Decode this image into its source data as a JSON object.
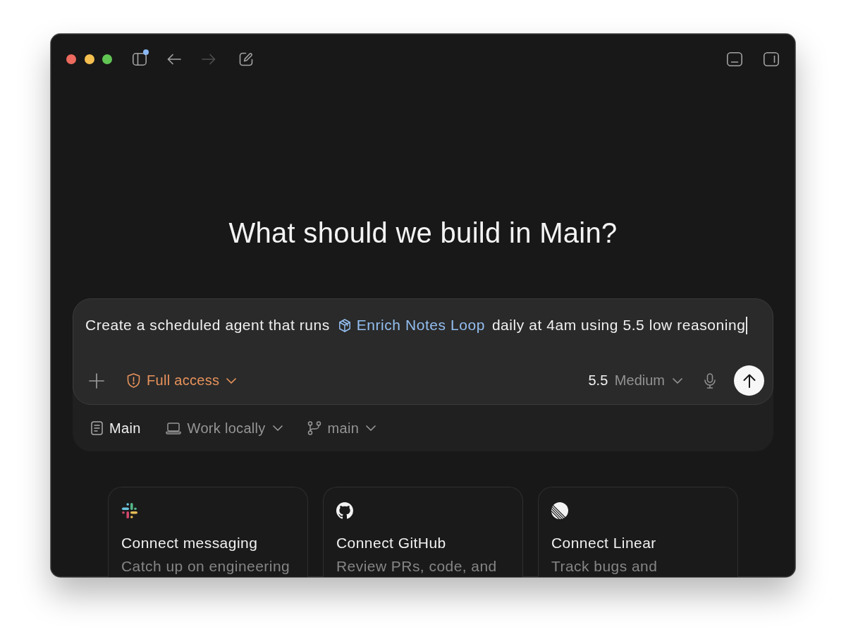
{
  "toolbar": {
    "left": [
      {
        "kind": "sidebar",
        "badge": true,
        "disabled": false
      },
      {
        "kind": "back",
        "badge": false,
        "disabled": false
      },
      {
        "kind": "forward",
        "badge": false,
        "disabled": true
      },
      {
        "kind": "compose",
        "badge": false,
        "disabled": false
      }
    ],
    "right": [
      {
        "kind": "bottom-panel"
      },
      {
        "kind": "side-panel"
      }
    ]
  },
  "heading": "What should we build in Main?",
  "composer": {
    "prompt": {
      "focused": true,
      "segments": [
        {
          "kind": "text",
          "text": "Create a scheduled agent that runs"
        },
        {
          "kind": "mention",
          "text": "Enrich Notes Loop"
        },
        {
          "kind": "text",
          "text": "daily at 4am using 5.5 low reasoning"
        }
      ]
    },
    "access": {
      "label": "Full access",
      "warning": true
    },
    "model": {
      "version": "5.5",
      "effort": "Medium"
    }
  },
  "context": [
    {
      "kind": "project",
      "label": "Main",
      "dropdown": false
    },
    {
      "kind": "environment",
      "label": "Work locally",
      "dropdown": true
    },
    {
      "kind": "branch",
      "label": "main",
      "dropdown": true
    }
  ],
  "cards": [
    {
      "kind": "messaging",
      "title": "Connect messaging",
      "description": "Catch up on engineering"
    },
    {
      "kind": "github",
      "title": "Connect GitHub",
      "description": "Review PRs, code, and"
    },
    {
      "kind": "linear",
      "title": "Connect Linear",
      "description": "Track bugs and"
    }
  ]
}
